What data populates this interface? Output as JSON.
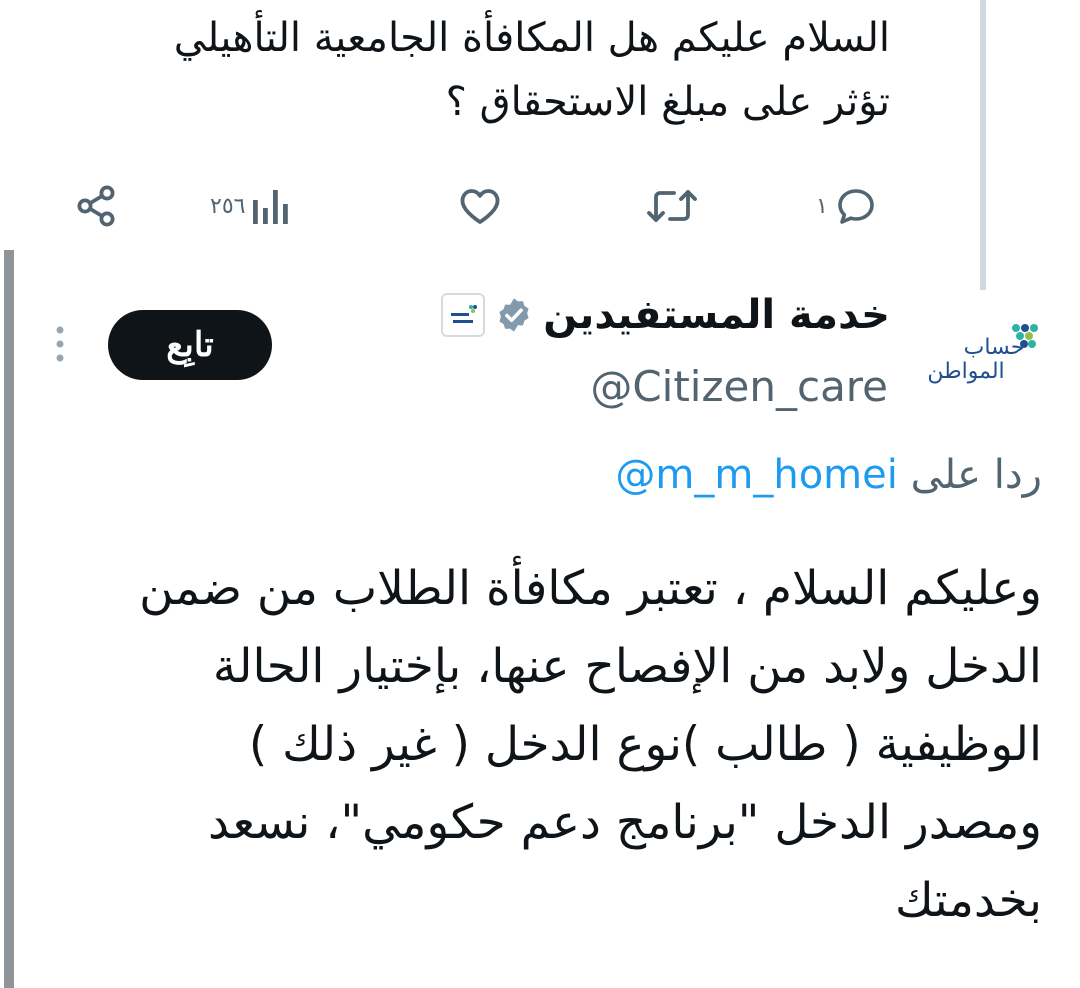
{
  "previous_tweet": {
    "line1": "السلام عليكم هل المكافأة الجامعية  التأهيلي",
    "line2": "تؤثر على مبلغ الاستحقاق ؟"
  },
  "actions": {
    "replies_count": "١",
    "views_count": "٢٥٦",
    "icons": [
      "reply-icon",
      "retweet-icon",
      "like-icon",
      "views-icon",
      "share-icon"
    ]
  },
  "reply_tweet": {
    "display_name": "خدمة المستفيدين",
    "handle": "@Citizen_care",
    "avatar_logo_text_1": "حساب",
    "avatar_logo_text_2": "المواطن",
    "follow_label": "تابِع",
    "reply_prefix": "ردا على",
    "reply_mention": "@m_m_homei",
    "body_lines": [
      "وعليكم السلام ، تعتبر مكافأة الطلاب من ضمن",
      "الدخل ولابد من الإفصاح عنها، بإختيار الحالة",
      "الوظيفية ( طالب )نوع الدخل ( غير ذلك )",
      "ومصدر الدخل \"برنامج دعم حكومي\"، نسعد",
      "بخدمتك"
    ]
  },
  "colors": {
    "text": "#0f1419",
    "secondary": "#536471",
    "link": "#1d9bf0",
    "button": "#0f1419",
    "logo_blue": "#1f4f8f",
    "logo_teal": "#2bb3a8",
    "logo_green": "#8bc34a"
  }
}
